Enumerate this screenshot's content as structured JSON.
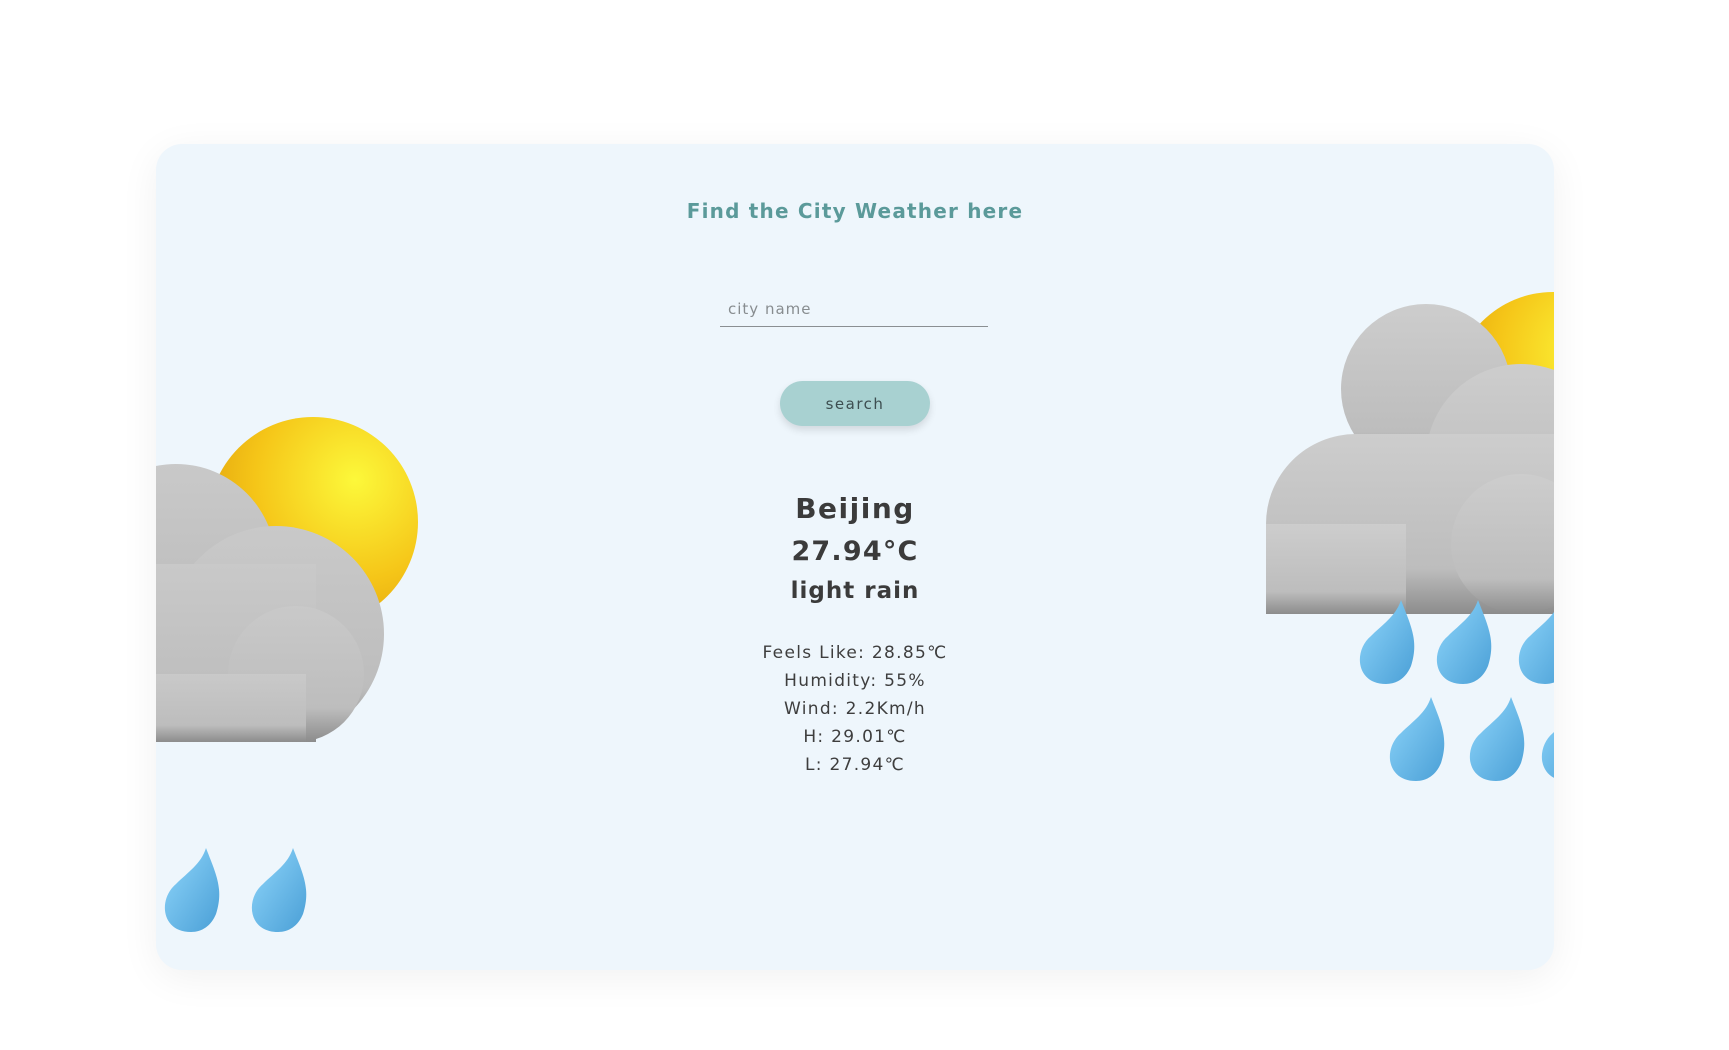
{
  "header": {
    "title": "Find the City Weather here"
  },
  "search": {
    "placeholder": "city name",
    "value": "",
    "button_label": "search"
  },
  "weather": {
    "city": "Beijing",
    "temperature": "27.94°C",
    "description": "light rain",
    "feels_like": "Feels Like: 28.85℃",
    "humidity": "Humidity: 55%",
    "wind": "Wind: 2.2Km/h",
    "high": "H: 29.01℃",
    "low": "L: 27.94℃"
  },
  "colors": {
    "card_background": "#eef6fc",
    "title": "#5b9a9a",
    "button": "#a8d1d1",
    "text": "#3b3b3b",
    "sun": "#f5c518",
    "cloud": "#bdbdbd",
    "raindrop": "#5fb3e6"
  },
  "icons": {
    "left_illustration": "sun-cloud-rain-icon",
    "right_illustration": "sun-cloud-rain-icon"
  }
}
